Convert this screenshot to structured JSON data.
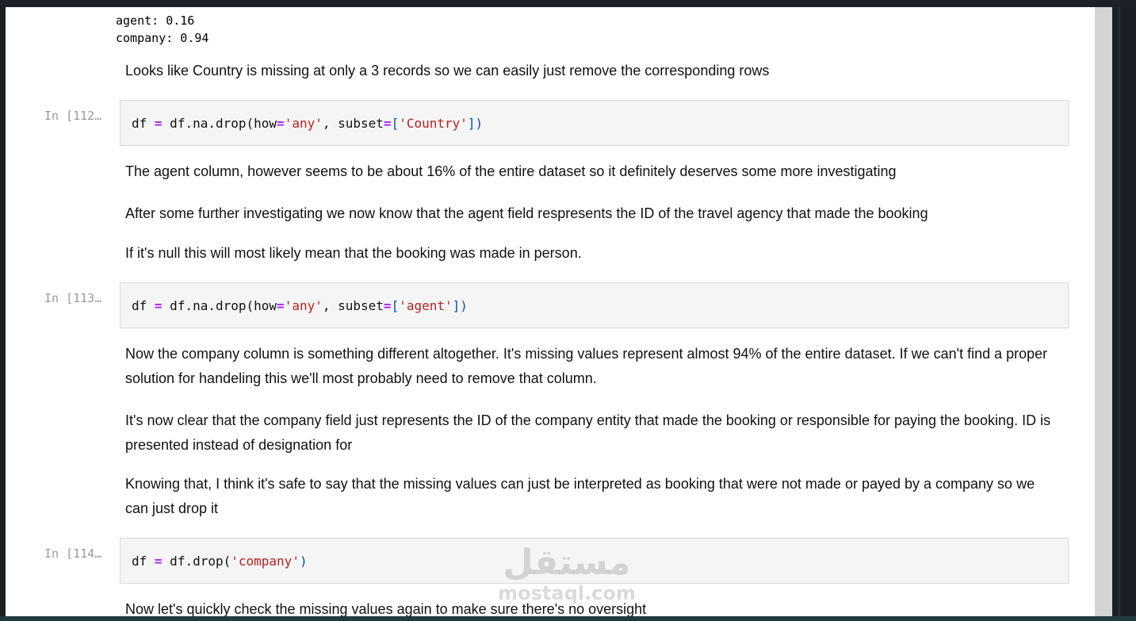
{
  "output": {
    "lines": [
      "agent: 0.16",
      "company: 0.94"
    ]
  },
  "cells": [
    {
      "type": "markdown",
      "text": "Looks like Country is missing at only a 3 records so we can easily just remove the corresponding rows"
    },
    {
      "type": "code",
      "prompt": "In [112…",
      "code": {
        "a": "df ",
        "eq": "=",
        "b": " df.na.drop(how",
        "eq2": "=",
        "s1": "'any'",
        "c": ", subset",
        "eq3": "=",
        "lb": "[",
        "s2": "'Country'",
        "rb": "])"
      }
    },
    {
      "type": "markdown",
      "text": "The agent column, however seems to be about 16% of the entire dataset so it definitely deserves some more investigating"
    },
    {
      "type": "markdown",
      "text": "After some further investigating we now know that the agent field respresents the ID of the travel agency that made the booking"
    },
    {
      "type": "markdown",
      "text": "If it's null this will most likely mean that the booking was made in person."
    },
    {
      "type": "code",
      "prompt": "In [113…",
      "code": {
        "a": "df ",
        "eq": "=",
        "b": " df.na.drop(how",
        "eq2": "=",
        "s1": "'any'",
        "c": ", subset",
        "eq3": "=",
        "lb": "[",
        "s2": "'agent'",
        "rb": "])"
      }
    },
    {
      "type": "markdown",
      "text": "Now the company column is something different altogether. It's missing values represent almost 94% of the entire dataset. If we can't find a proper solution for handeling this we'll most probably need to remove that column."
    },
    {
      "type": "markdown",
      "text": "It's now clear that the company field just represents the ID of the company entity that made the booking or responsible for paying the booking. ID is presented instead of designation for"
    },
    {
      "type": "markdown",
      "text": "Knowing that, I think it's safe to say that the missing values can just be interpreted as booking that were not made or payed by a company so we can just drop it"
    },
    {
      "type": "code",
      "prompt": "In [114…",
      "code": {
        "a": "df ",
        "eq": "=",
        "b": " df.drop(",
        "s1": "'company'",
        "rb": ")"
      }
    },
    {
      "type": "markdown",
      "text": "Now let's quickly check the missing values again to make sure there's no oversight"
    }
  ],
  "watermark": {
    "arabic": "مستقل",
    "latin": "mostaql.com"
  }
}
